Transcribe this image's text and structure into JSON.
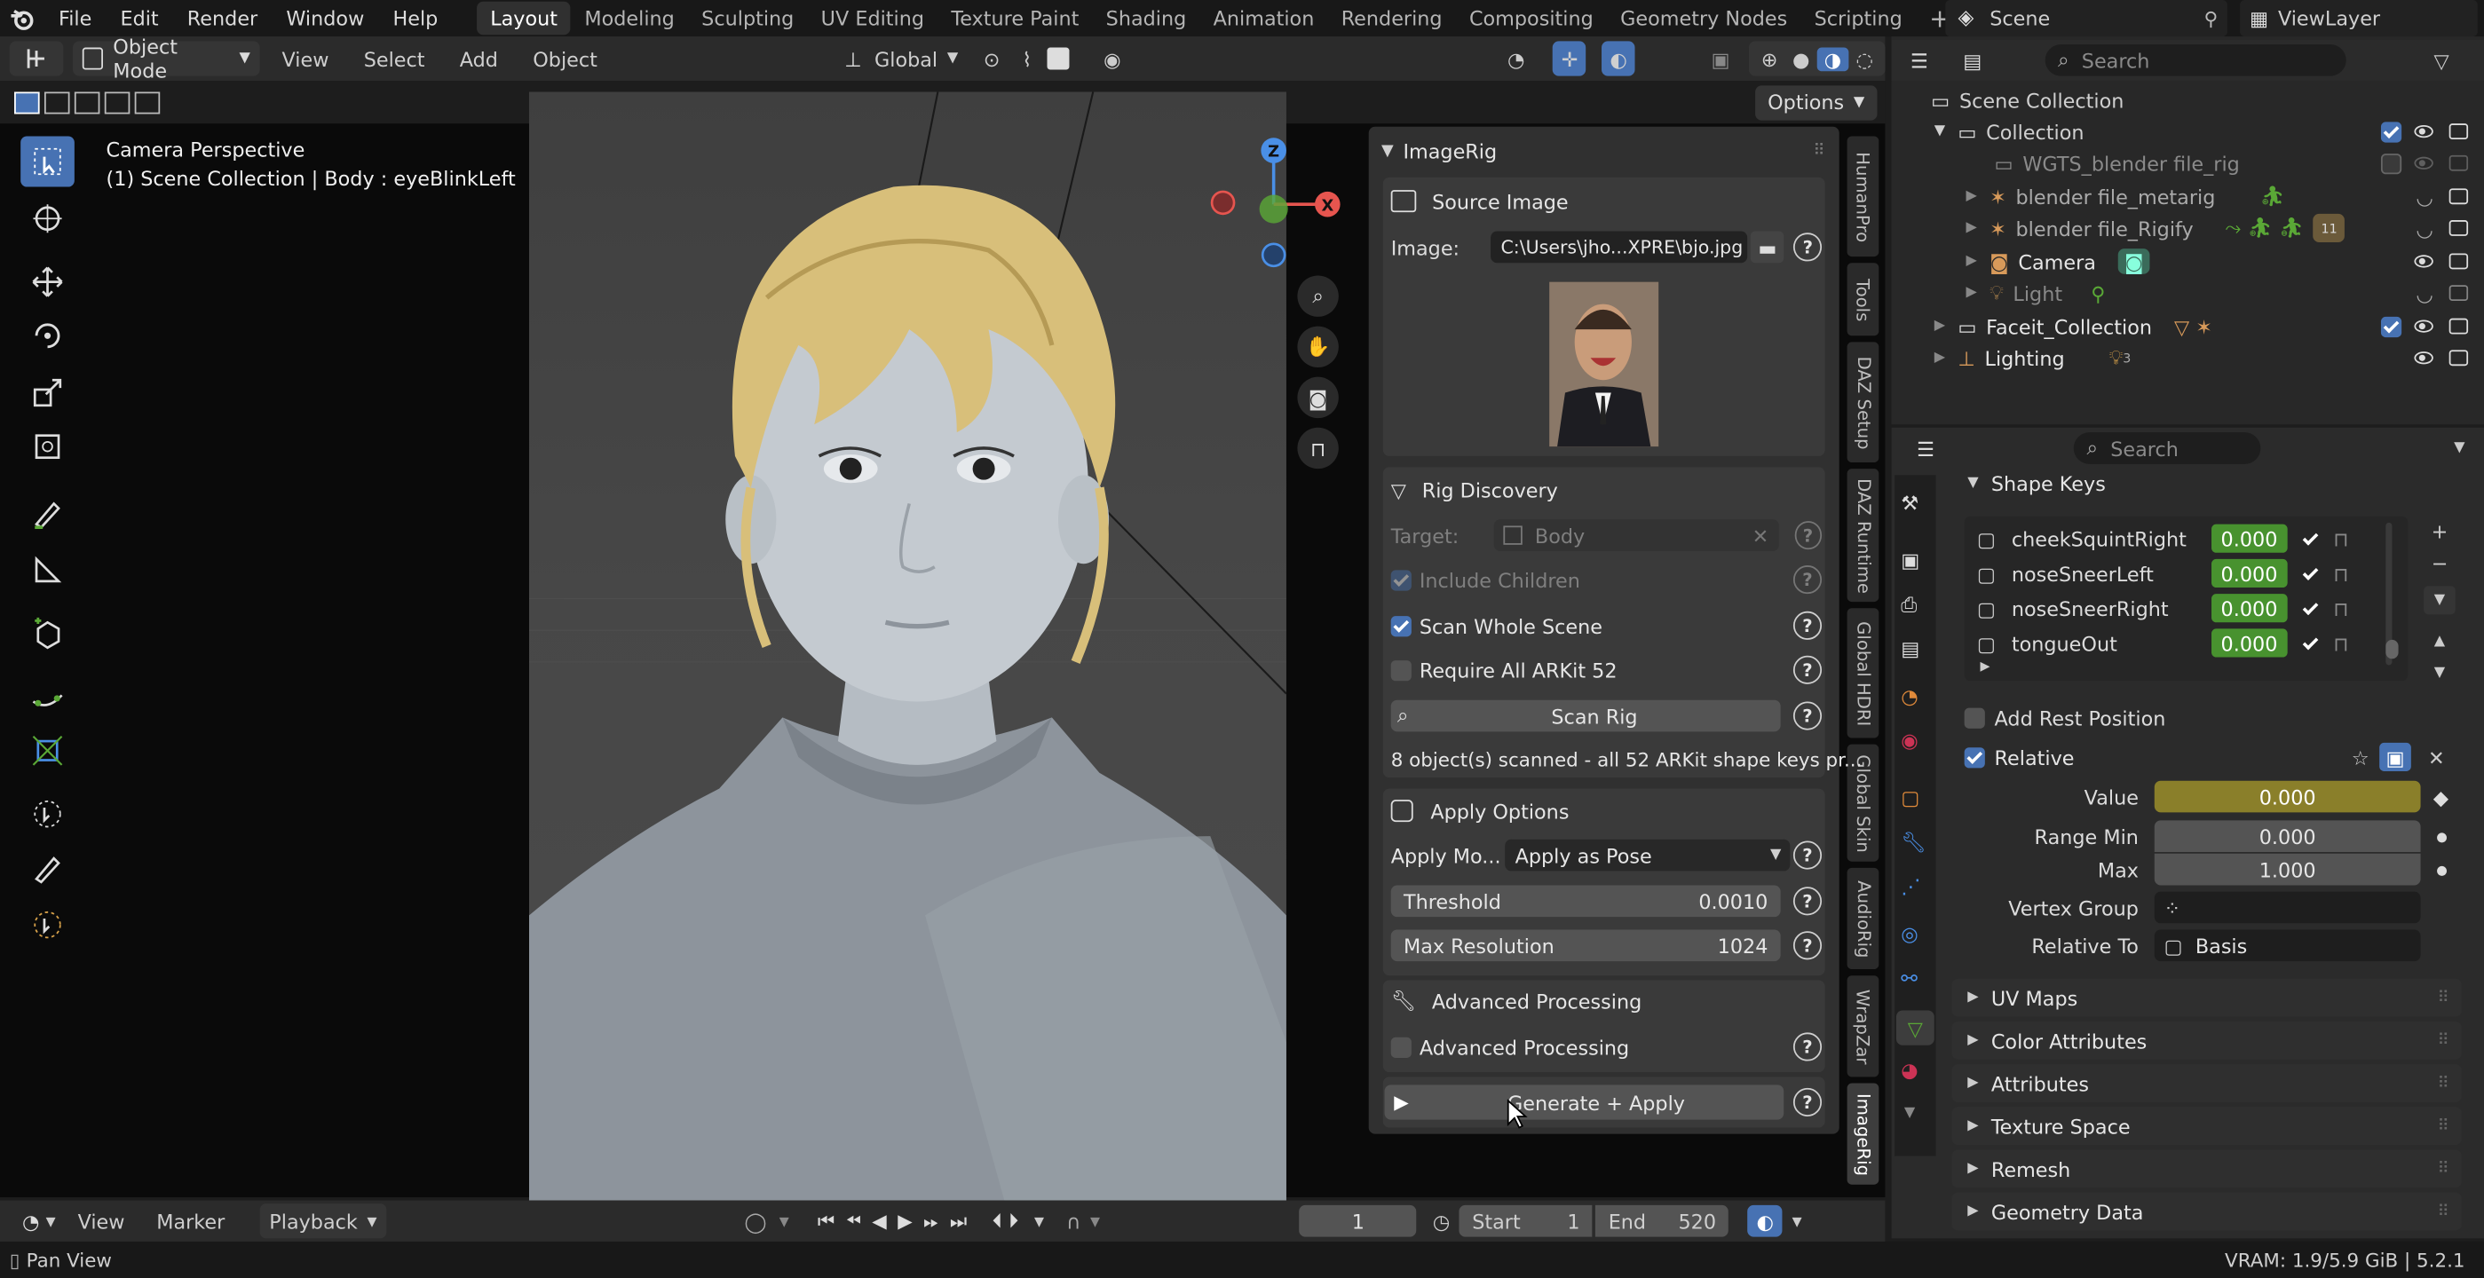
{
  "top_menu": {
    "items": [
      "File",
      "Edit",
      "Render",
      "Window",
      "Help"
    ]
  },
  "workspaces": {
    "tabs": [
      "Layout",
      "Modeling",
      "Sculpting",
      "UV Editing",
      "Texture Paint",
      "Shading",
      "Animation",
      "Rendering",
      "Compositing",
      "Geometry Nodes",
      "Scripting"
    ],
    "active": "Layout",
    "add": "+"
  },
  "scene": {
    "name": "Scene",
    "view_layer": "ViewLayer"
  },
  "viewport_header": {
    "mode": "Object Mode",
    "menus": [
      "View",
      "Select",
      "Add",
      "Object"
    ],
    "orientation": "Global",
    "options": "Options"
  },
  "viewport": {
    "camera_label": "Camera Perspective",
    "collection_label": "(1) Scene Collection | Body : eyeBlinkLeft",
    "gizmo": {
      "z": "Z",
      "x": "X"
    }
  },
  "n_tabs": [
    "HumanPro",
    "Tools",
    "DAZ Setup",
    "DAZ Runtime",
    "Global HDRI",
    "Global Skin",
    "AudioRig",
    "WrapZar",
    "ImageRig"
  ],
  "imagerig": {
    "title": "ImageRig",
    "source_image": {
      "header": "Source Image",
      "image_label": "Image:",
      "image_path": "C:\\Users\\jho...XPRE\\bjo.jpg"
    },
    "rig_discovery": {
      "header": "Rig Discovery",
      "target_label": "Target:",
      "target_value": "Body",
      "include_children": "Include Children",
      "scan_whole_scene": "Scan Whole Scene",
      "require_arkit": "Require All ARKit 52",
      "scan_button": "Scan Rig",
      "status": "8 object(s) scanned - all 52 ARKit shape keys pr..."
    },
    "apply_options": {
      "header": "Apply Options",
      "apply_mode_label": "Apply Mo...",
      "apply_mode_value": "Apply as Pose",
      "threshold_label": "Threshold",
      "threshold_value": "0.0010",
      "max_res_label": "Max Resolution",
      "max_res_value": "1024"
    },
    "advanced": {
      "header": "Advanced Processing",
      "checkbox_label": "Advanced Processing"
    },
    "generate_button": "Generate + Apply"
  },
  "outliner": {
    "search_placeholder": "Search",
    "rows": [
      {
        "label": "Scene Collection"
      },
      {
        "label": "Collection"
      },
      {
        "label": "WGTS_blender file_rig"
      },
      {
        "label": "blender file_metarig"
      },
      {
        "label": "blender file_Rigify"
      },
      {
        "label": "Camera"
      },
      {
        "label": "Light"
      },
      {
        "label": "Faceit_Collection"
      },
      {
        "label": "Lighting"
      }
    ],
    "rigify_badge": "11",
    "lighting_badge": "3"
  },
  "properties": {
    "search_placeholder": "Search",
    "shape_keys_header": "Shape Keys",
    "shape_keys": [
      {
        "name": "cheekSquintRight",
        "value": "0.000"
      },
      {
        "name": "noseSneerLeft",
        "value": "0.000"
      },
      {
        "name": "noseSneerRight",
        "value": "0.000"
      },
      {
        "name": "tongueOut",
        "value": "0.000"
      }
    ],
    "add_rest_position": "Add Rest Position",
    "relative": "Relative",
    "value_label": "Value",
    "value": "0.000",
    "range_min_label": "Range Min",
    "range_min": "0.000",
    "max_label": "Max",
    "max": "1.000",
    "vertex_group_label": "Vertex Group",
    "relative_to_label": "Relative To",
    "relative_to": "Basis",
    "collapsed_sections": [
      "UV Maps",
      "Color Attributes",
      "Attributes",
      "Texture Space",
      "Remesh",
      "Geometry Data"
    ]
  },
  "timeline": {
    "menus": [
      "View",
      "Marker"
    ],
    "playback": "Playback",
    "current_frame": "1",
    "start_label": "Start",
    "start": "1",
    "end_label": "End",
    "end": "520"
  },
  "status_bar": {
    "left": "Pan View",
    "right": "VRAM: 1.9/5.9 GiB | 5.2.1"
  },
  "colors": {
    "accent_blue": "#4772b3",
    "value_green": "#48922f",
    "value_yellow": "#8a7f2a",
    "bg": "#1d1d1d",
    "panel": "#303030"
  }
}
